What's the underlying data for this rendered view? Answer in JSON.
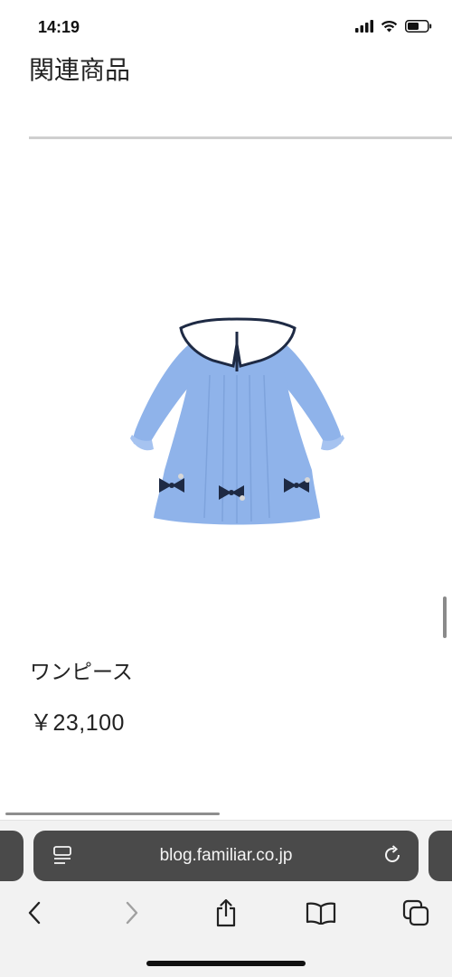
{
  "status": {
    "time": "14:19"
  },
  "section": {
    "title": "関連商品"
  },
  "product": {
    "name": "ワンピース",
    "price": "￥23,100",
    "image_icon": "dress-image"
  },
  "browser": {
    "url": "blog.familiar.co.jp"
  },
  "toolbar": {
    "back": "chevron-left-icon",
    "forward": "chevron-right-icon",
    "share": "share-icon",
    "bookmarks": "book-icon",
    "tabs": "tabs-icon"
  },
  "colors": {
    "dress": "#8fb3ea",
    "collar": "#ffffff",
    "bow": "#1e2a44",
    "address_bar": "#4a4a4a"
  }
}
